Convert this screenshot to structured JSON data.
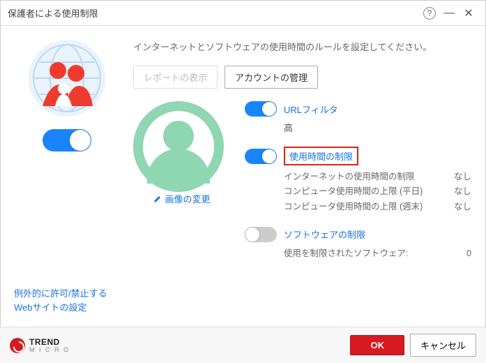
{
  "window": {
    "title": "保護者による使用制限"
  },
  "instruction": "インターネットとソフトウェアの使用時間のルールを設定してください。",
  "buttons": {
    "report": "レポートの表示",
    "manage_account": "アカウントの管理"
  },
  "avatar": {
    "change_label": "画像の変更"
  },
  "sections": {
    "url_filter": {
      "title": "URLフィルタ",
      "level": "高",
      "enabled": true
    },
    "time_limit": {
      "title": "使用時間の制限",
      "enabled": true,
      "rows": [
        {
          "label": "インターネットの使用時間の制限",
          "value": "なし"
        },
        {
          "label": "コンピュータ使用時間の上限 (平日)",
          "value": "なし"
        },
        {
          "label": "コンピュータ使用時間の上限 (週末)",
          "value": "なし"
        }
      ]
    },
    "software_limit": {
      "title": "ソフトウェアの制限",
      "enabled": false,
      "row": {
        "label": "使用を制限されたソフトウェア:",
        "value": "0"
      }
    }
  },
  "exceptions_link": "例外的に許可/禁止する\nWebサイトの設定",
  "footer": {
    "brand": "TREND",
    "brand_sub": "M I C R O",
    "ok": "OK",
    "cancel": "キャンセル"
  }
}
